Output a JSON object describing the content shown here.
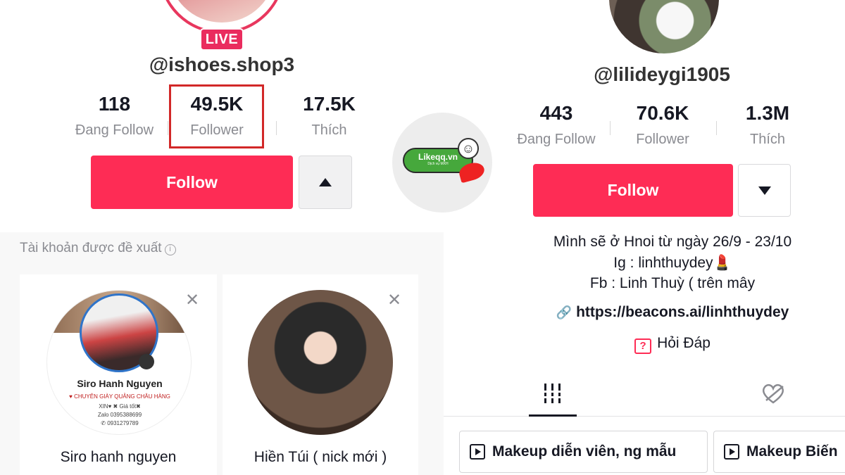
{
  "left_profile": {
    "badge": "LIVE",
    "username": "@ishoes.shop3",
    "stats": [
      {
        "value": "118",
        "label": "Đang Follow"
      },
      {
        "value": "49.5K",
        "label": "Follower"
      },
      {
        "value": "17.5K",
        "label": "Thích"
      }
    ],
    "follow_label": "Follow"
  },
  "suggested": {
    "title": "Tài khoản được đề xuất",
    "cards": [
      {
        "name": "Siro hanh nguyen",
        "avatar_title": "Siro Hanh Nguyen",
        "avatar_line1": "♥ CHUYÊN GIÀY QUẢNG CHÂU HÀNG",
        "avatar_line2": "XIN♥ ✖ Giá tốt✖",
        "avatar_line3": "Zalo 0395388699",
        "avatar_line4": "✆ 0931279789"
      },
      {
        "name": "Hiền Túi ( nick mới )"
      }
    ]
  },
  "watermark": {
    "text": "Likeqq.vn",
    "subtext": "Dịch vụ MXH"
  },
  "right_profile": {
    "username": "@lilideygi1905",
    "stats": [
      {
        "value": "443",
        "label": "Đang Follow"
      },
      {
        "value": "70.6K",
        "label": "Follower"
      },
      {
        "value": "1.3M",
        "label": "Thích"
      }
    ],
    "follow_label": "Follow",
    "bio": [
      "Mình sẽ ở Hnoi từ ngày 26/9 - 23/10",
      "Ig : linhthuydey💄",
      "Fb : Linh Thuỳ ( trên mây"
    ],
    "link": "https://beacons.ai/linhthuydey",
    "qa_label": "Hỏi Đáp",
    "playlists": [
      "Makeup diễn viên, ng mẫu",
      "Makeup Biến"
    ]
  },
  "colors": {
    "primary": "#fe2c55",
    "highlight": "#d22828",
    "muted": "#8a8b91"
  }
}
